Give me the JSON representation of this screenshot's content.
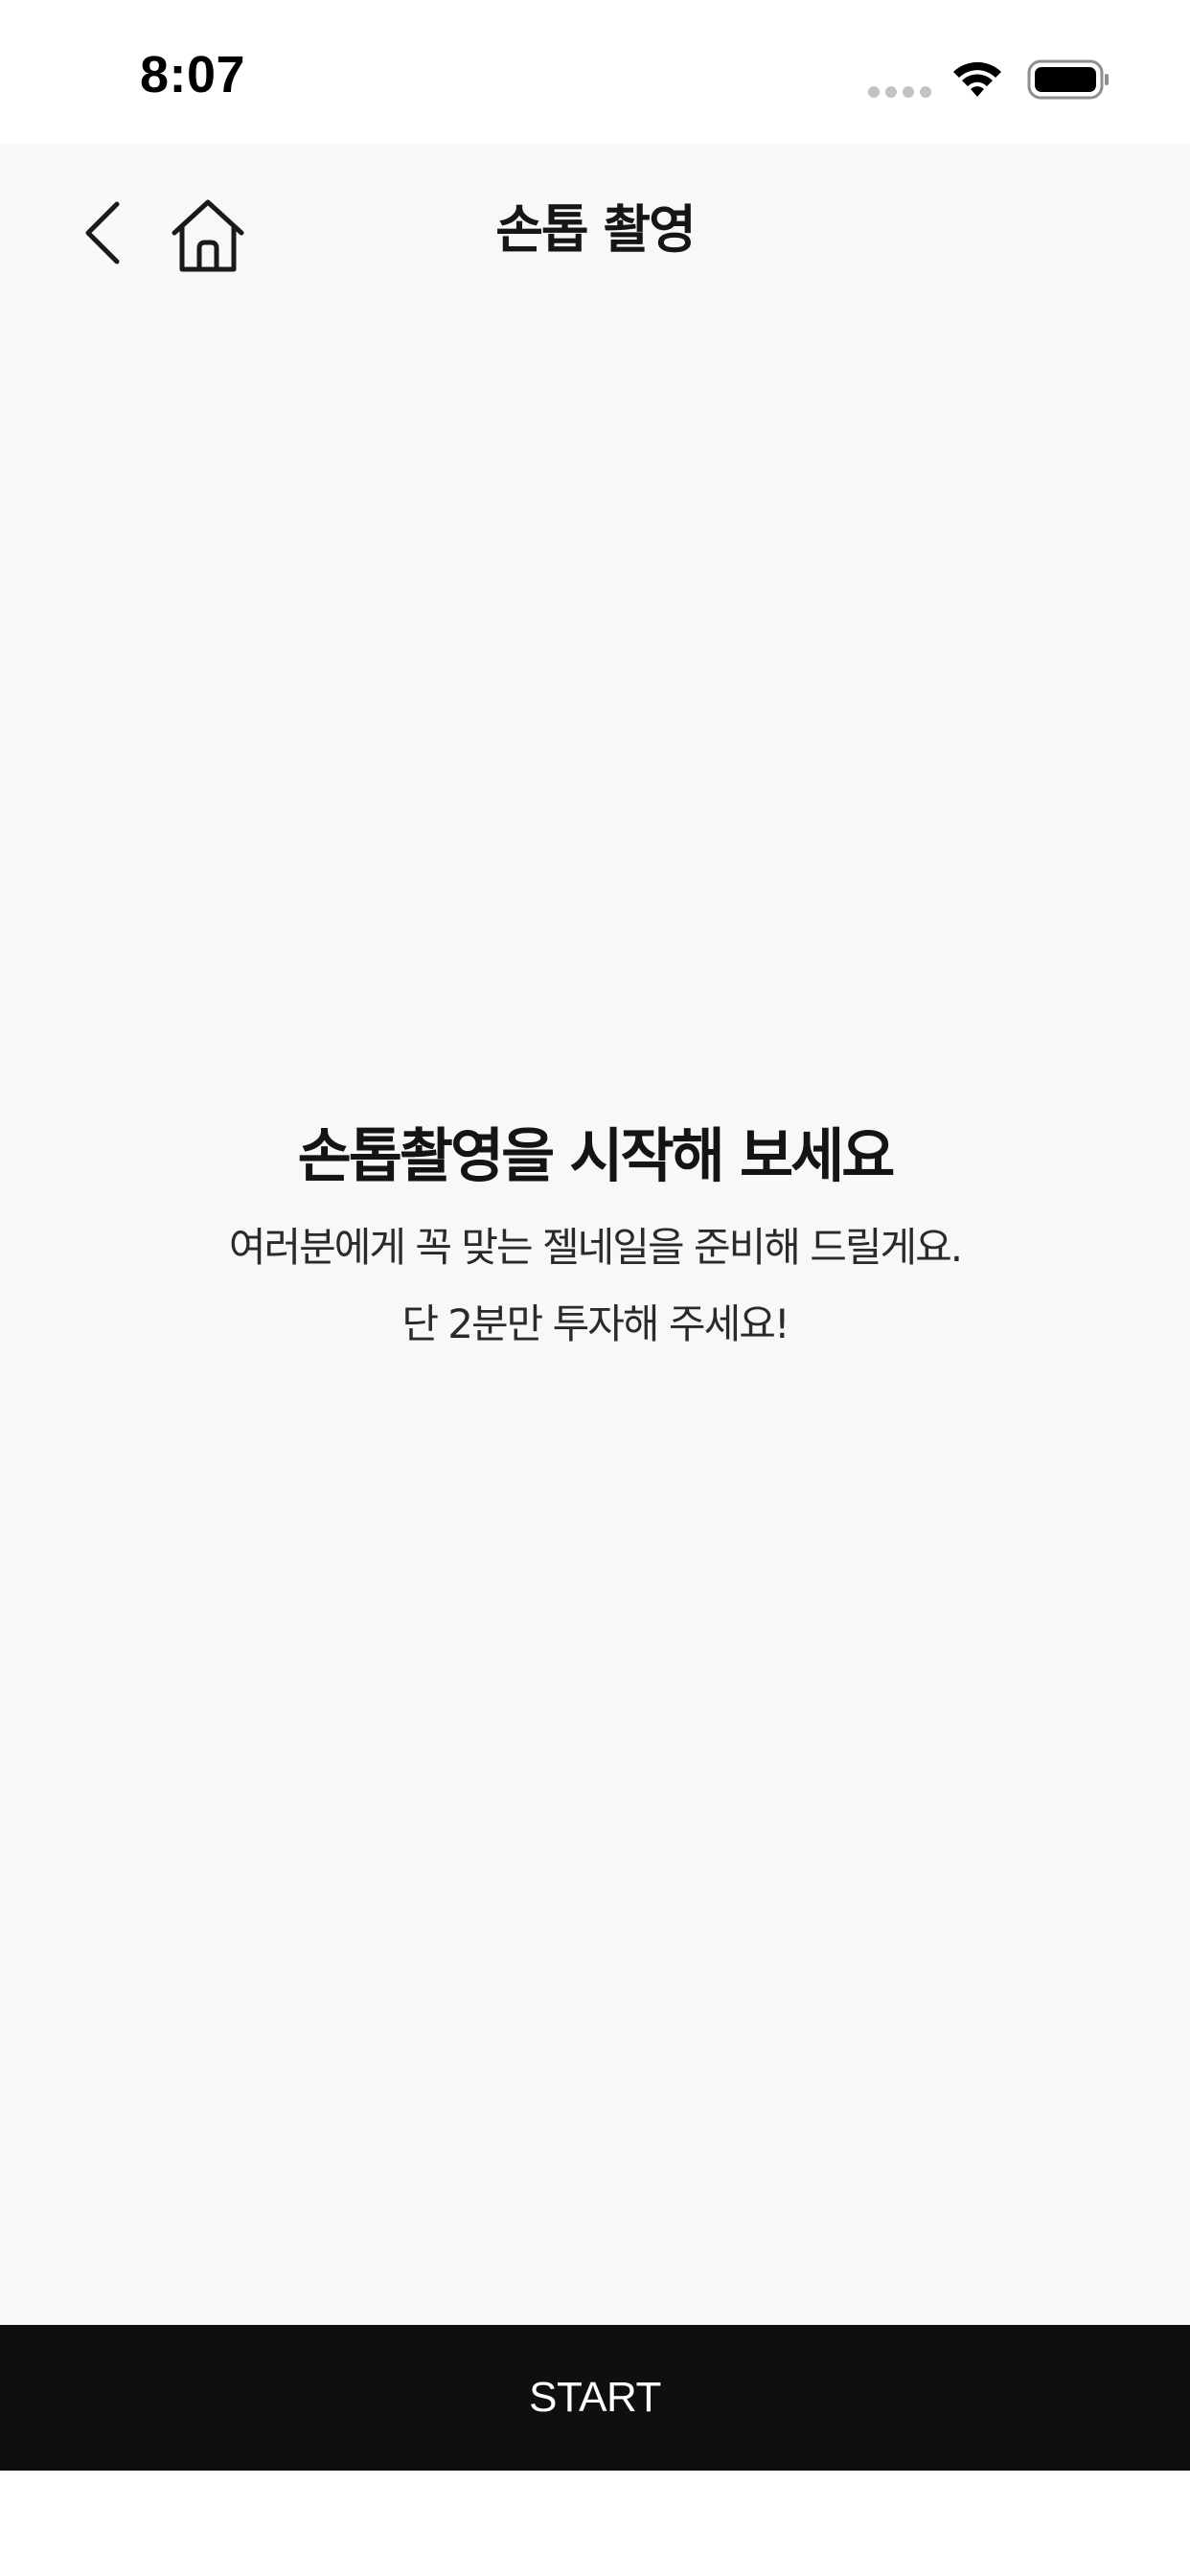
{
  "status_bar": {
    "time": "8:07",
    "signal_icon": "signal-dots-icon",
    "wifi_icon": "wifi-icon",
    "battery_icon": "battery-icon"
  },
  "nav": {
    "title": "손톱 촬영",
    "back_icon": "chevron-left-icon",
    "home_icon": "home-icon"
  },
  "intro": {
    "headline": "손톱촬영을 시작해 보세요",
    "line1": "여러분에게 꼭 맞는 젤네일을 준비해 드릴게요.",
    "line2": "단 2분만 투자해 주세요!"
  },
  "actions": {
    "start_label": "START"
  },
  "colors": {
    "background": "#f9f8f6",
    "button": "#0f0f0f",
    "button_text": "#ffffff",
    "text": "#141414"
  }
}
